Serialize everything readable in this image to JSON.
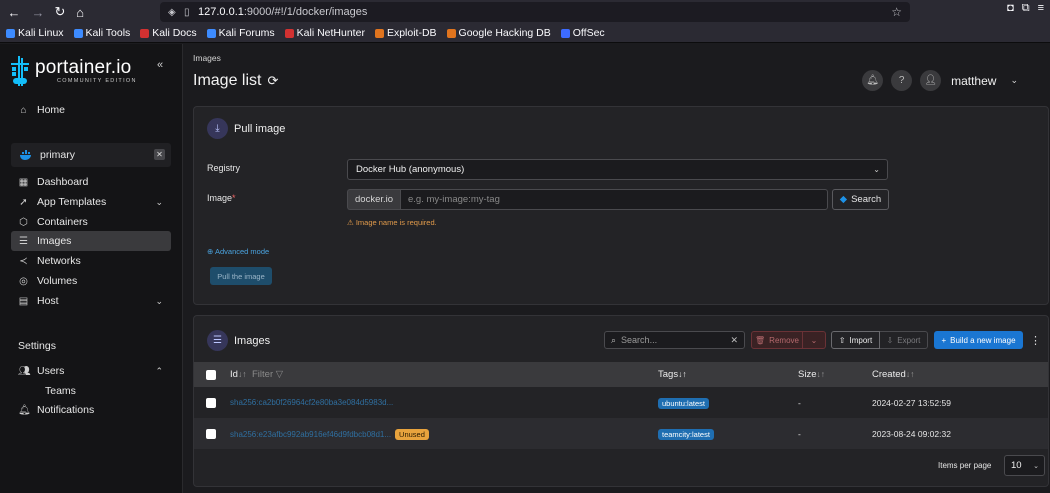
{
  "browser": {
    "url_prefix": "127.0.0.1",
    "url_rest": ":9000/#!/1/docker/images",
    "bookmarks": [
      {
        "label": "Kali Linux",
        "color": "#3d8bff"
      },
      {
        "label": "Kali Tools",
        "color": "#3d8bff"
      },
      {
        "label": "Kali Docs",
        "color": "#d23131"
      },
      {
        "label": "Kali Forums",
        "color": "#3d8bff"
      },
      {
        "label": "Kali NetHunter",
        "color": "#d23131"
      },
      {
        "label": "Exploit-DB",
        "color": "#e0741e"
      },
      {
        "label": "Google Hacking DB",
        "color": "#e0741e"
      },
      {
        "label": "OffSec",
        "color": "#3d6bff"
      }
    ]
  },
  "sidebar": {
    "logo_word": "portainer.io",
    "logo_sub": "COMMUNITY EDITION",
    "home": "Home",
    "environment": "primary",
    "items": [
      {
        "label": "Dashboard",
        "icon": "dashboard-icon"
      },
      {
        "label": "App Templates",
        "icon": "rocket-icon"
      },
      {
        "label": "Containers",
        "icon": "box-icon"
      },
      {
        "label": "Images",
        "icon": "list-icon"
      },
      {
        "label": "Networks",
        "icon": "share-icon"
      },
      {
        "label": "Volumes",
        "icon": "database-icon"
      },
      {
        "label": "Host",
        "icon": "server-icon"
      }
    ],
    "settings_label": "Settings",
    "users": "Users",
    "teams": "Teams",
    "notifications": "Notifications"
  },
  "header": {
    "breadcrumb": "Images",
    "title": "Image list",
    "user": "matthew"
  },
  "pull": {
    "title": "Pull image",
    "registry_label": "Registry",
    "registry_value": "Docker Hub (anonymous)",
    "image_label": "Image",
    "prefix": "docker.io",
    "placeholder": "e.g. my-image:my-tag",
    "search_label": "Search",
    "warning": "Image name is required.",
    "advanced": "Advanced mode",
    "pull_button": "Pull the image"
  },
  "images": {
    "title": "Images",
    "search_placeholder": "Search...",
    "remove_label": "Remove",
    "import_label": "Import",
    "export_label": "Export",
    "build_label": "Build a new image",
    "columns": {
      "id": "Id",
      "filter": "Filter",
      "tags": "Tags",
      "size": "Size",
      "created": "Created"
    },
    "rows": [
      {
        "id": "sha256:ca2b0f26964cf2e80ba3e084d5983d...",
        "unused": "",
        "tag": "ubuntu:latest",
        "size": "-",
        "created": "2024-02-27 13:52:59"
      },
      {
        "id": "sha256:e23afbc992ab916ef46d9fdbcb08d1...",
        "unused": "Unused",
        "tag": "teamcity:latest",
        "size": "-",
        "created": "2023-08-24 09:02:32"
      }
    ],
    "items_per_page_label": "Items per page",
    "items_per_page": "10"
  }
}
